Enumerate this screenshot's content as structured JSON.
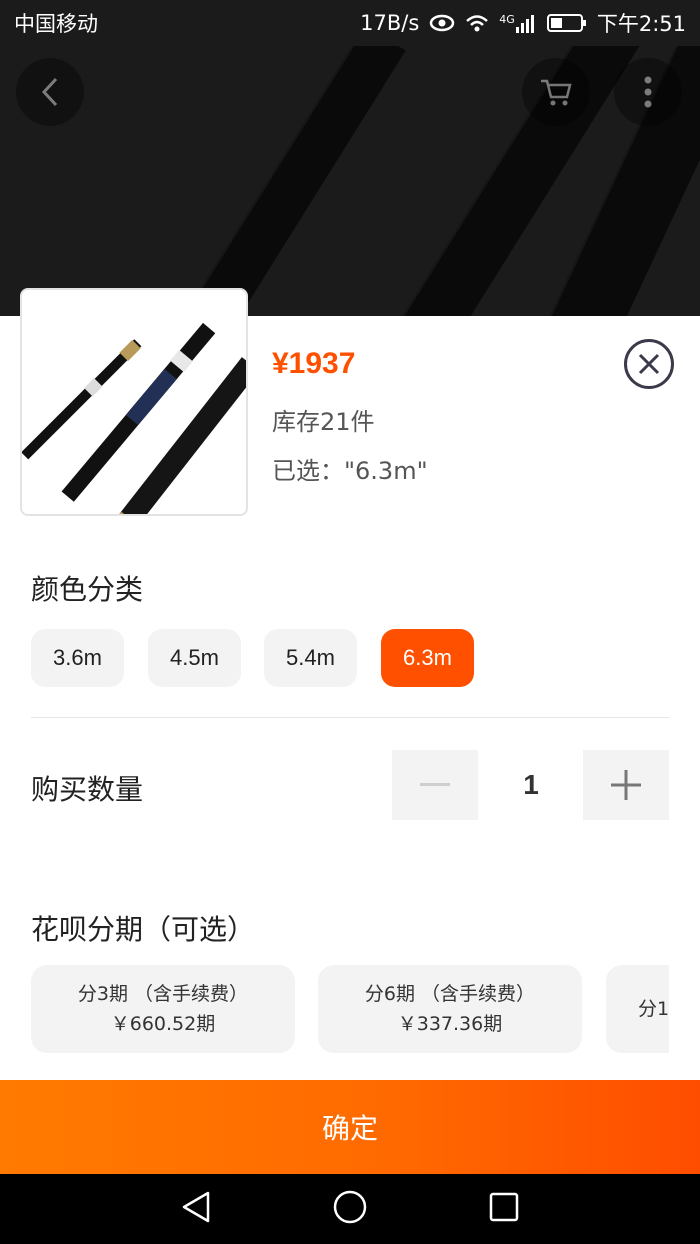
{
  "status_bar": {
    "carrier": "中国移动",
    "net_speed": "17B/s",
    "signal_label": "4G",
    "time": "下午2:51",
    "icons": [
      "eye-icon",
      "wifi-icon",
      "signal-icon",
      "battery-icon"
    ]
  },
  "hero": {
    "back_icon": "back-icon",
    "cart_icon": "cart-icon",
    "more_icon": "more-icon"
  },
  "product": {
    "price": "¥1937",
    "stock": "库存21件",
    "selected": "已选：\"6.3m\""
  },
  "color_section": {
    "title": "颜色分类",
    "options": [
      "3.6m",
      "4.5m",
      "5.4m",
      "6.3m"
    ],
    "selected_index": 3
  },
  "quantity": {
    "label": "购买数量",
    "value": "1",
    "minus_label": "−",
    "plus_label": "+"
  },
  "installment": {
    "title": "花呗分期（可选）",
    "plans": [
      {
        "line1": "分3期 （含手续费）",
        "line2": "￥660.52期"
      },
      {
        "line1": "分6期 （含手续费）",
        "line2": "￥337.36期"
      },
      {
        "line1": "分1",
        "line2": ""
      }
    ]
  },
  "confirm_label": "确定",
  "colors": {
    "accent": "#ff5000",
    "chip_bg": "#f3f3f3"
  },
  "nav": {
    "icons": [
      "nav-back-icon",
      "nav-home-icon",
      "nav-recents-icon"
    ]
  }
}
